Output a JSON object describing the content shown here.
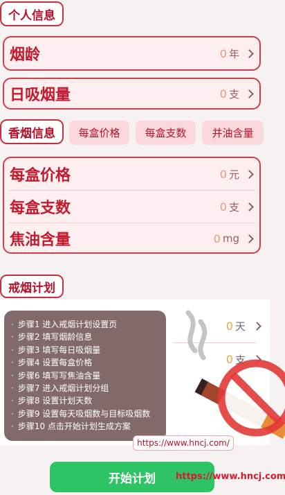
{
  "personal": {
    "title": "个人信息",
    "years": {
      "label": "烟龄",
      "value": "0",
      "unit": "年"
    },
    "daily": {
      "label": "日吸烟量",
      "value": "0",
      "unit": "支"
    }
  },
  "cigarette": {
    "title": "香烟信息",
    "chips": [
      "每盒价格",
      "每盒支数",
      "并油含量"
    ],
    "price": {
      "label": "每盒价格",
      "value": "0",
      "unit": "元"
    },
    "count": {
      "label": "每盒支数",
      "value": "0",
      "unit": "支"
    },
    "tar": {
      "label": "焦油含量",
      "value": "0",
      "unit": "mg"
    }
  },
  "plan": {
    "title": "戒烟计划",
    "days": {
      "value": "0",
      "unit": "天"
    },
    "target": {
      "value": "0",
      "unit": "支"
    }
  },
  "steps": [
    "步骤1 进入戒烟计划设置页",
    "步骤2 填写烟龄信息",
    "步骤3 填写每日吸烟量",
    "步骤4 设置每盒价格",
    "步骤6 填写写焦油含量",
    "步骤7 进入戒烟计划分组",
    "步骤8 设置计划天数",
    "步骤9 设置每天吸烟数与目标吸烟数",
    "步骤10 点击开始计划生成方案"
  ],
  "watermark": "https://www.hncj.com/",
  "start_button": "开始计划",
  "corner_url": "https://www.hncj.com/",
  "icons": [
    "chevron-right-icon",
    "no-smoking-icon",
    "cigarette-icon"
  ],
  "colors": {
    "accent": "#c41a2d",
    "card_bg": "#fdeef0",
    "button": "#2ec466"
  }
}
